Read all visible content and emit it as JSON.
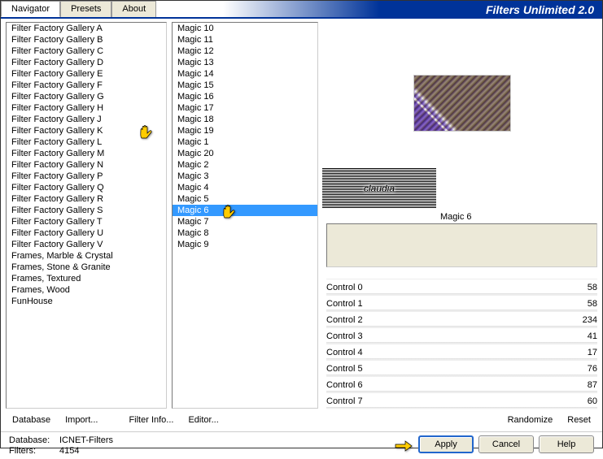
{
  "header": {
    "tabs": [
      "Navigator",
      "Presets",
      "About"
    ],
    "title": "Filters Unlimited 2.0"
  },
  "categories": [
    "Filter Factory Gallery A",
    "Filter Factory Gallery B",
    "Filter Factory Gallery C",
    "Filter Factory Gallery D",
    "Filter Factory Gallery E",
    "Filter Factory Gallery F",
    "Filter Factory Gallery G",
    "Filter Factory Gallery H",
    "Filter Factory Gallery J",
    "Filter Factory Gallery K",
    "Filter Factory Gallery L",
    "Filter Factory Gallery M",
    "Filter Factory Gallery N",
    "Filter Factory Gallery P",
    "Filter Factory Gallery Q",
    "Filter Factory Gallery R",
    "Filter Factory Gallery S",
    "Filter Factory Gallery T",
    "Filter Factory Gallery U",
    "Filter Factory Gallery V",
    "Frames, Marble & Crystal",
    "Frames, Stone & Granite",
    "Frames, Textured",
    "Frames, Wood",
    "FunHouse"
  ],
  "selected_category_index": 9,
  "filters": [
    "Magic 10",
    "Magic 11",
    "Magic 12",
    "Magic 13",
    "Magic 14",
    "Magic 15",
    "Magic 16",
    "Magic 17",
    "Magic 18",
    "Magic 19",
    "Magic 1",
    "Magic 20",
    "Magic 2",
    "Magic 3",
    "Magic 4",
    "Magic 5",
    "Magic 6",
    "Magic 7",
    "Magic 8",
    "Magic 9"
  ],
  "selected_filter_index": 16,
  "current_filter": "Magic 6",
  "watermark": "claudia",
  "controls": [
    {
      "label": "Control 0",
      "value": 58
    },
    {
      "label": "Control 1",
      "value": 58
    },
    {
      "label": "Control 2",
      "value": 234
    },
    {
      "label": "Control 3",
      "value": 41
    },
    {
      "label": "Control 4",
      "value": 17
    },
    {
      "label": "Control 5",
      "value": 76
    },
    {
      "label": "Control 6",
      "value": 87
    },
    {
      "label": "Control 7",
      "value": 60
    }
  ],
  "buttons": {
    "database": "Database",
    "import": "Import...",
    "filter_info": "Filter Info...",
    "editor": "Editor...",
    "randomize": "Randomize",
    "reset": "Reset",
    "apply": "Apply",
    "cancel": "Cancel",
    "help": "Help"
  },
  "status": {
    "db_label": "Database:",
    "db_value": "ICNET-Filters",
    "filters_label": "Filters:",
    "filters_value": "4154"
  }
}
